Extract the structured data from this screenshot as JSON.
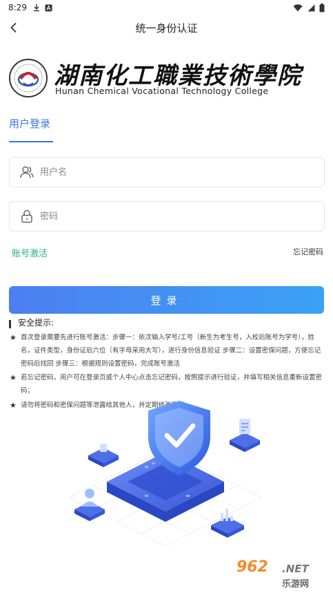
{
  "status_bar": {
    "time": "8:29"
  },
  "nav": {
    "title": "统一身份认证"
  },
  "logo": {
    "name_cn": "湖南化工職業技術學院",
    "name_en": "Hunan Chemical Vocational  Technology College"
  },
  "tabs": {
    "login_label": "用户登录"
  },
  "form": {
    "username_placeholder": "用户名",
    "username_value": "",
    "password_placeholder": "密码",
    "password_value": "",
    "activate_label": "账号激活",
    "forgot_label": "忘记密码",
    "submit_label": "登录"
  },
  "tips": {
    "title": "安全提示:",
    "items": [
      "首次登录需要先进行账号激活：步骤一：依次输入学号/工号（新生为考生号，入校后账号为学号），姓名，证件类型，身份证后六位（有字母采用大写），进行身份信息验证 步骤二：设置密保问题，方便忘记密码后找回 步骤三：根据规则设置密码，完成账号激活",
      "若忘记密码，用户可在登录页或个人中心点击忘记密码，按照提示进行验证，并填写相关信息重新设置密码；",
      "请勿将密码和密保问题等泄露给其他人，并定期修改密码。"
    ]
  },
  "watermark": {
    "number": "962",
    "domain": ".NET",
    "name": "乐游网"
  },
  "colors": {
    "accent": "#3a73e8",
    "link_green": "#2ab07f",
    "button_start": "#4d7ff0",
    "button_end": "#3aa2f5"
  }
}
